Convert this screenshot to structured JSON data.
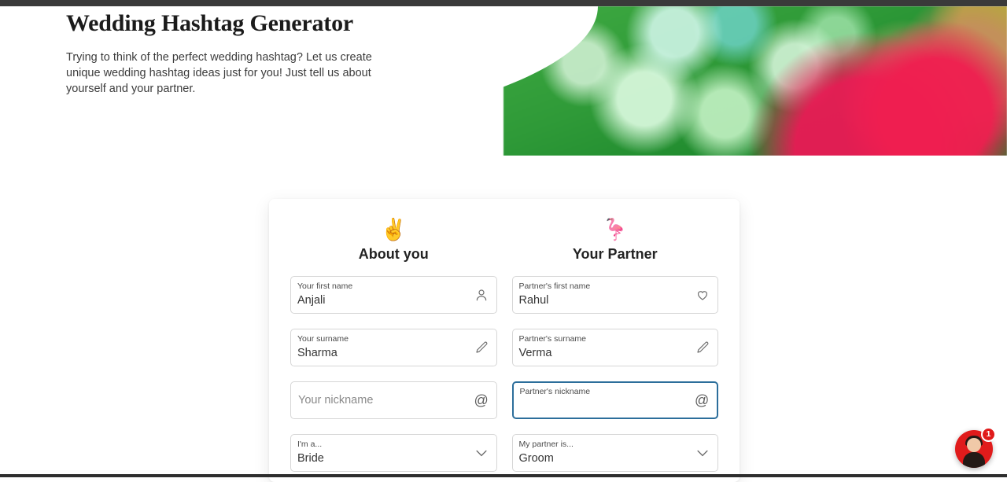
{
  "page": {
    "background": "#ffffff",
    "accent_focus_color": "#2c6e9b",
    "chat_color": "#e01b1b"
  },
  "hero": {
    "title": "Wedding Hashtag Generator",
    "description": "Trying to think of the perfect wedding hashtag? Let us create unique wedding hashtag ideas just for you! Just tell us about yourself and your partner.",
    "photo_alt": "henna-decorated-hands-wedding-photo"
  },
  "form": {
    "columns": [
      {
        "emoji": "✌️",
        "emoji_name": "peace-hand-emoji",
        "title": "About you",
        "fields": [
          {
            "name": "your-first-name",
            "type": "text",
            "label": "Your first name",
            "value": "Anjali",
            "placeholder": "",
            "icon": "user-icon",
            "focused": false
          },
          {
            "name": "your-surname",
            "type": "text",
            "label": "Your surname",
            "value": "Sharma",
            "placeholder": "",
            "icon": "pencil-icon",
            "focused": false
          },
          {
            "name": "your-nickname",
            "type": "text",
            "label": "",
            "value": "",
            "placeholder": "Your nickname",
            "icon": "at-icon",
            "focused": false
          },
          {
            "name": "your-role-select",
            "type": "select",
            "label": "I'm a...",
            "value": "Bride",
            "placeholder": "",
            "icon": "chevron-down-icon",
            "focused": false
          }
        ]
      },
      {
        "emoji": "🦩",
        "emoji_name": "flamingo-emoji",
        "title": "Your Partner",
        "fields": [
          {
            "name": "partner-first-name",
            "type": "text",
            "label": "Partner's first name",
            "value": "Rahul",
            "placeholder": "",
            "icon": "heart-icon",
            "focused": false
          },
          {
            "name": "partner-surname",
            "type": "text",
            "label": "Partner's surname",
            "value": "Verma",
            "placeholder": "",
            "icon": "pencil-icon",
            "focused": false
          },
          {
            "name": "partner-nickname",
            "type": "text",
            "label": "Partner's nickname",
            "value": "",
            "placeholder": "",
            "icon": "at-icon",
            "focused": true
          },
          {
            "name": "partner-role-select",
            "type": "select",
            "label": "My partner is...",
            "value": "Groom",
            "placeholder": "",
            "icon": "chevron-down-icon",
            "focused": false
          }
        ]
      }
    ]
  },
  "chat_widget": {
    "name": "chat-launcher",
    "badge_count": "1",
    "avatar_alt": "support-agent-avatar"
  }
}
